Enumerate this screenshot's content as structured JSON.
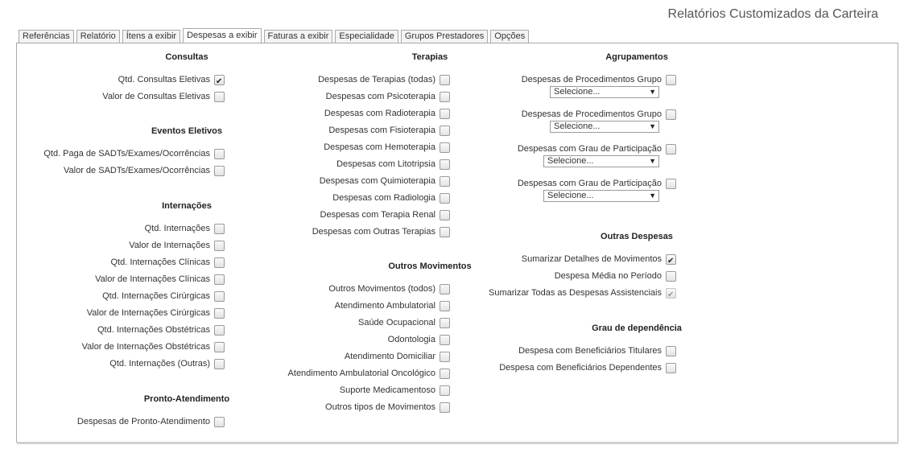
{
  "title": "Relatórios Customizados da Carteira",
  "tabs": [
    "Referências",
    "Relatório",
    "Ítens a exibir",
    "Despesas a exibir",
    "Faturas a exibir",
    "Especialidade",
    "Grupos Prestadores",
    "Opções"
  ],
  "active_tab": "Despesas a exibir",
  "col1": {
    "consultas": {
      "title": "Consultas",
      "items": [
        "Qtd. Consultas Eletivas",
        "Valor de Consultas Eletivas"
      ]
    },
    "eventos": {
      "title": "Eventos Eletivos",
      "items": [
        "Qtd. Paga de SADTs/Exames/Ocorrências",
        "Valor de SADTs/Exames/Ocorrências"
      ]
    },
    "internacoes": {
      "title": "Internações",
      "items": [
        "Qtd. Internações",
        "Valor de Internações",
        "Qtd. Internações Clínicas",
        "Valor de Internações Clínicas",
        "Qtd. Internações Cirúrgicas",
        "Valor de Internações Cirúrgicas",
        "Qtd. Internações Obstétricas",
        "Valor de Internações Obstétricas",
        "Qtd. Internações (Outras)"
      ]
    },
    "pronto": {
      "title": "Pronto-Atendimento",
      "items": [
        "Despesas de Pronto-Atendimento"
      ]
    }
  },
  "col2": {
    "terapias": {
      "title": "Terapias",
      "items": [
        "Despesas de Terapias (todas)",
        "Despesas com Psicoterapia",
        "Despesas com Radioterapia",
        "Despesas com Fisioterapia",
        "Despesas com Hemoterapia",
        "Despesas com Litotripsia",
        "Despesas com Quimioterapia",
        "Despesas com Radiologia",
        "Despesas com Terapia Renal",
        "Despesas com Outras Terapias"
      ]
    },
    "outros_mov": {
      "title": "Outros Movimentos",
      "items": [
        "Outros Movimentos (todos)",
        "Atendimento Ambulatorial",
        "Saúde Ocupacional",
        "Odontologia",
        "Atendimento Domiciliar",
        "Atendimento Ambulatorial Oncológico",
        "Suporte Medicamentoso",
        "Outros tipos de Movimentos"
      ]
    }
  },
  "col3": {
    "agrupamentos": {
      "title": "Agrupamentos",
      "items": [
        "Despesas de Procedimentos Grupo",
        "Despesas de Procedimentos Grupo",
        "Despesas com Grau de Participação",
        "Despesas com Grau de Participação"
      ],
      "select_value": "Selecione..."
    },
    "outras_despesas": {
      "title": "Outras Despesas",
      "items": [
        "Sumarizar Detalhes de Movimentos",
        "Despesa Média no Período",
        "Sumarizar Todas as Despesas Assistenciais"
      ]
    },
    "grau": {
      "title": "Grau de dependência",
      "items": [
        "Despesa com Beneficiários Titulares",
        "Despesa com Beneficiários Dependentes"
      ]
    }
  },
  "checked": [
    "Qtd. Consultas Eletivas",
    "Sumarizar Detalhes de Movimentos",
    "Sumarizar Todas as Despesas Assistenciais"
  ],
  "disabled": [
    "Sumarizar Todas as Despesas Assistenciais"
  ]
}
